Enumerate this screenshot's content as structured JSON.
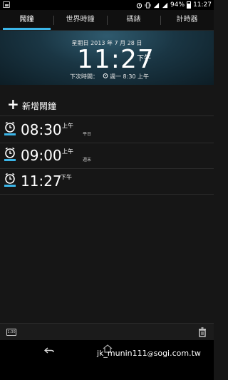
{
  "status_bar": {
    "battery": "94%",
    "time": "11:27"
  },
  "tabs": [
    {
      "label": "鬧鐘",
      "active": true
    },
    {
      "label": "世界時鐘",
      "active": false
    },
    {
      "label": "碼錶",
      "active": false
    },
    {
      "label": "計時器",
      "active": false
    }
  ],
  "header": {
    "date": "星期日  2013 年 7 月 28 日",
    "time": "11:27",
    "ampm": "下午",
    "next_label": "下次時間：",
    "next_value": "週一 8:30 上午"
  },
  "add_alarm": {
    "label": "新增鬧鐘"
  },
  "alarms": [
    {
      "time": "08:30",
      "ampm": "上午",
      "days": "平日",
      "enabled": true
    },
    {
      "time": "09:00",
      "ampm": "上午",
      "days": "週末",
      "enabled": true
    },
    {
      "time": "11:27",
      "ampm": "下午",
      "days": "",
      "enabled": true
    }
  ],
  "toolbar": {
    "left_icon": "clock-format-icon",
    "left_text": "1:30",
    "right_icon": "trash-icon"
  },
  "navbar": {
    "watermark": "jk_munin111",
    "watermark_site": "sogi.com.tw"
  },
  "colors": {
    "accent": "#3bb5e8",
    "background": "#161616"
  }
}
